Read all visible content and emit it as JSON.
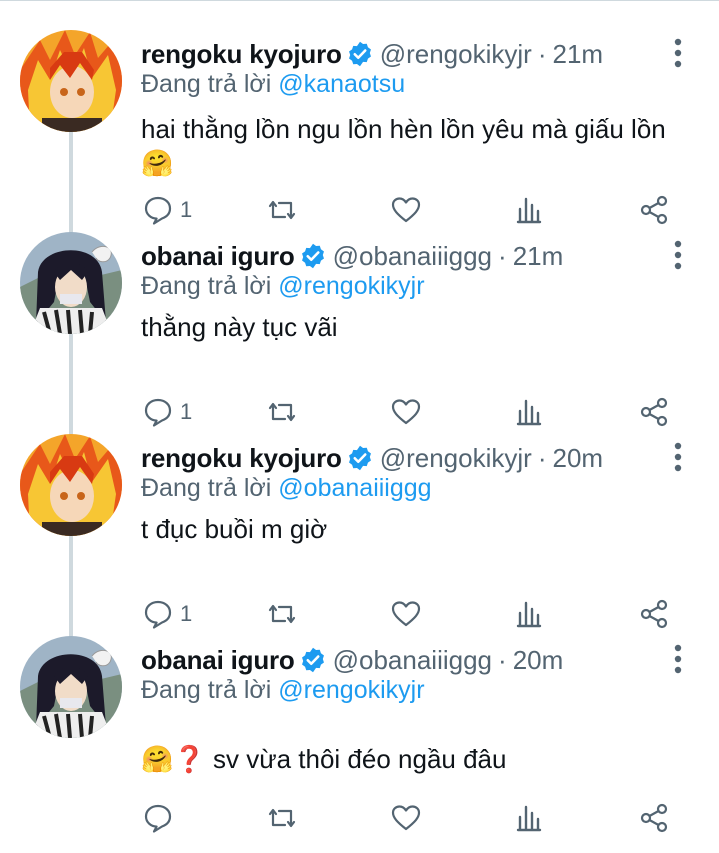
{
  "colors": {
    "accent": "#1d9bf0",
    "secondary_text": "#536471",
    "thread_line": "#cfd9de"
  },
  "reply_prefix": "Đang trả lời",
  "tweets": [
    {
      "name": "rengoku kyojuro",
      "handle": "@rengokikyjr",
      "time": "21m",
      "reply_to": "@kanaotsu",
      "text": "hai thằng lồn ngu lồn hèn lồn yêu mà giấu lồn 🤗",
      "reply_count": "1",
      "avatar_icon": "flame-hair-avatar"
    },
    {
      "name": "obanai iguro",
      "handle": "@obanaiiiggg",
      "time": "21m",
      "reply_to": "@rengokikyjr",
      "text": "thằng này tục vãi",
      "reply_count": "1",
      "avatar_icon": "dark-hair-avatar"
    },
    {
      "name": "rengoku kyojuro",
      "handle": "@rengokikyjr",
      "time": "20m",
      "reply_to": "@obanaiiiggg",
      "text": "t đục buồi m giờ",
      "reply_count": "1",
      "avatar_icon": "flame-hair-avatar"
    },
    {
      "name": "obanai iguro",
      "handle": "@obanaiiiggg",
      "time": "20m",
      "reply_to": "@rengokikyjr",
      "text": "🤗❓ sv vừa thôi đéo ngầu đâu",
      "reply_count": "",
      "avatar_icon": "dark-hair-avatar"
    }
  ]
}
